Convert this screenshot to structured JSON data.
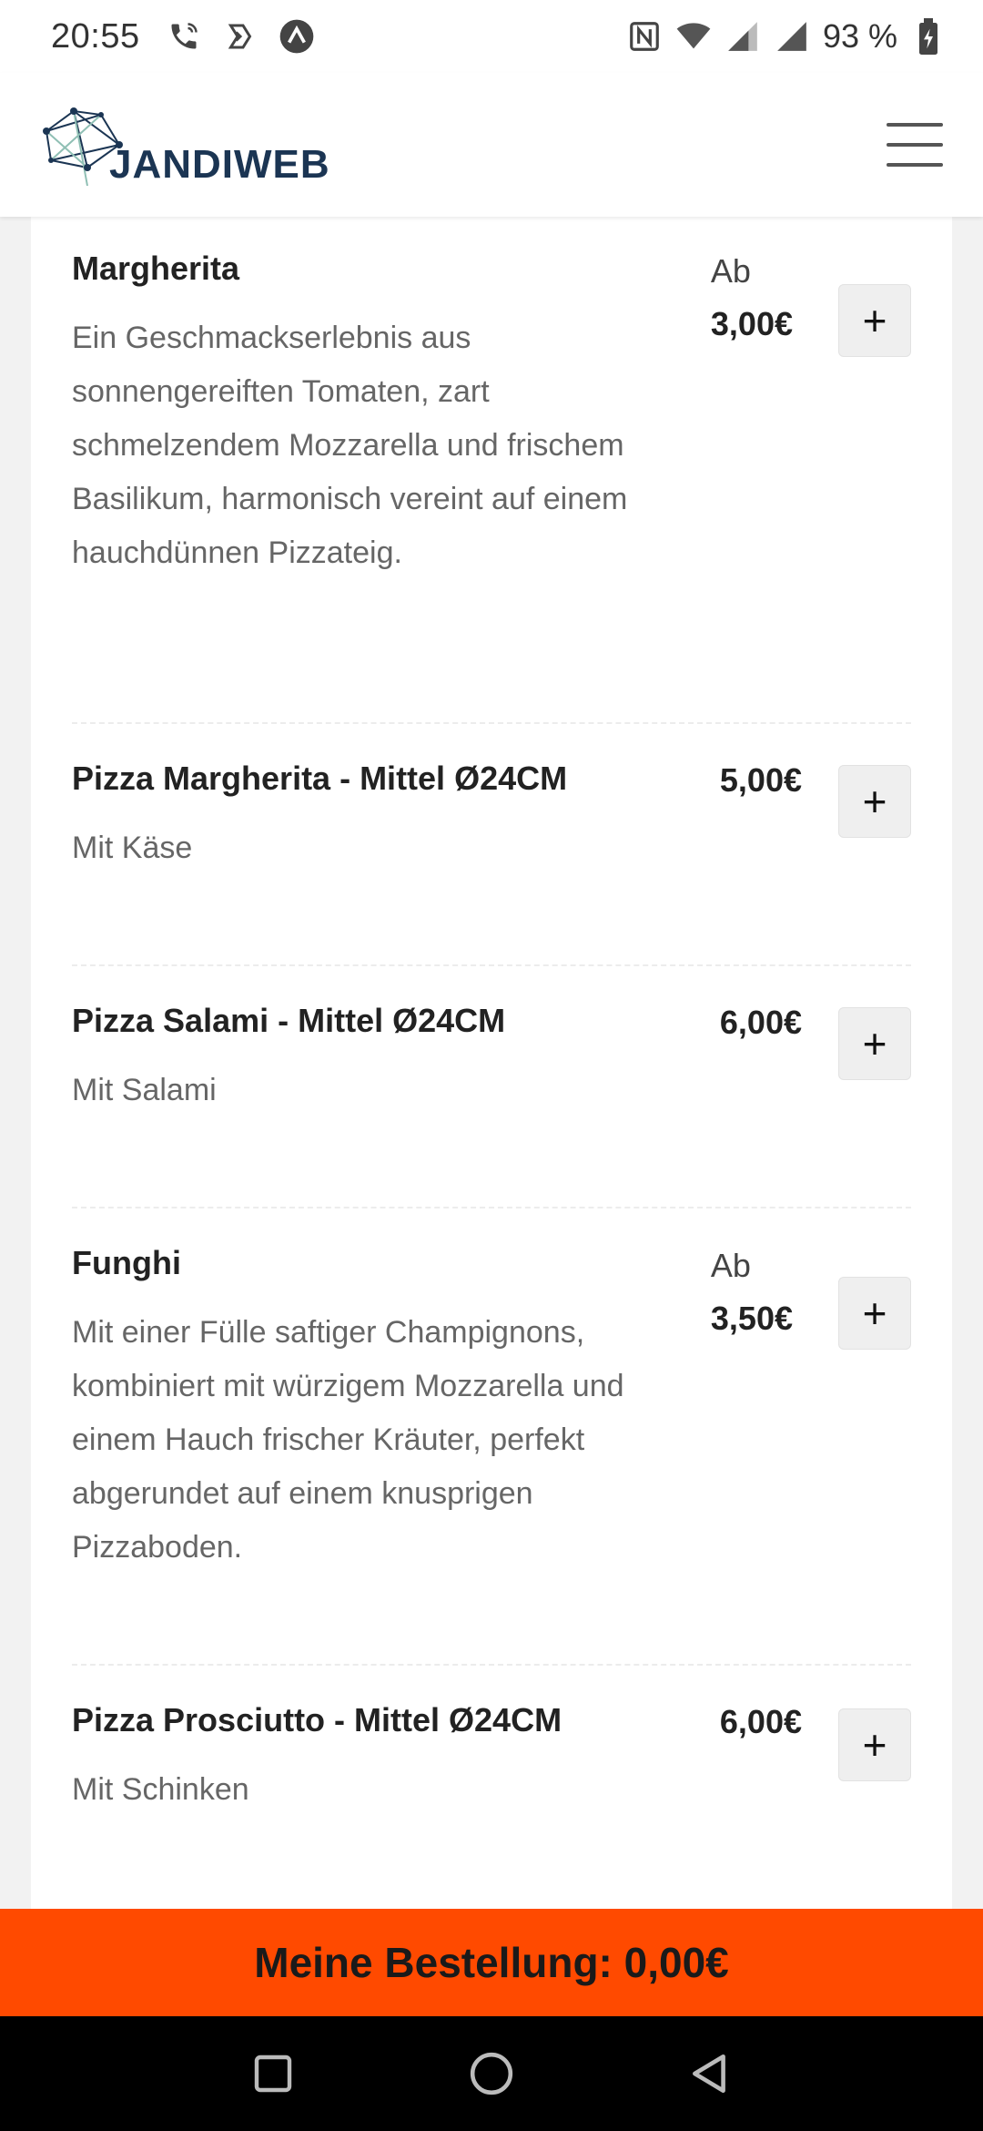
{
  "status_bar": {
    "time": "20:55",
    "left_icons": [
      "phone-wifi-icon",
      "sync-icon",
      "arrow-app-icon"
    ],
    "right_icons": [
      "nfc-icon",
      "wifi-icon",
      "signal-icon",
      "signal-icon"
    ],
    "battery_text": "93 %"
  },
  "header": {
    "logo_text": "JANDIWEB",
    "menu_icon": "hamburger-icon"
  },
  "menu": {
    "items": [
      {
        "name": "Margherita",
        "description": "Ein Geschmackserlebnis aus sonnengereiften Tomaten, zart schmelzendem Mozzarella und frischem Basilikum, harmonisch vereint auf einem hauchdünnen Pizzateig.",
        "price_prefix": "Ab",
        "price": "3,00€",
        "add_label": "+"
      },
      {
        "name": "Pizza Margherita - Mittel Ø24CM",
        "description": "Mit Käse",
        "price_prefix": "",
        "price": "5,00€",
        "add_label": "+"
      },
      {
        "name": "Pizza Salami - Mittel Ø24CM",
        "description": "Mit Salami",
        "price_prefix": "",
        "price": "6,00€",
        "add_label": "+"
      },
      {
        "name": "Funghi",
        "description": "Mit einer Fülle saftiger Champignons, kombiniert mit würzigem Mozzarella und einem Hauch frischer Kräuter, perfekt abgerundet auf einem knusprigen Pizzaboden.",
        "price_prefix": "Ab",
        "price": "3,50€",
        "add_label": "+"
      },
      {
        "name": "Pizza Prosciutto - Mittel Ø24CM",
        "description": "Mit Schinken",
        "price_prefix": "",
        "price": "6,00€",
        "add_label": "+"
      }
    ]
  },
  "order_bar": {
    "label": "Meine Bestellung: 0,00€"
  },
  "colors": {
    "accent": "#ff4a00",
    "logo": "#1b3553",
    "logo_secondary": "#8fbfb4"
  }
}
